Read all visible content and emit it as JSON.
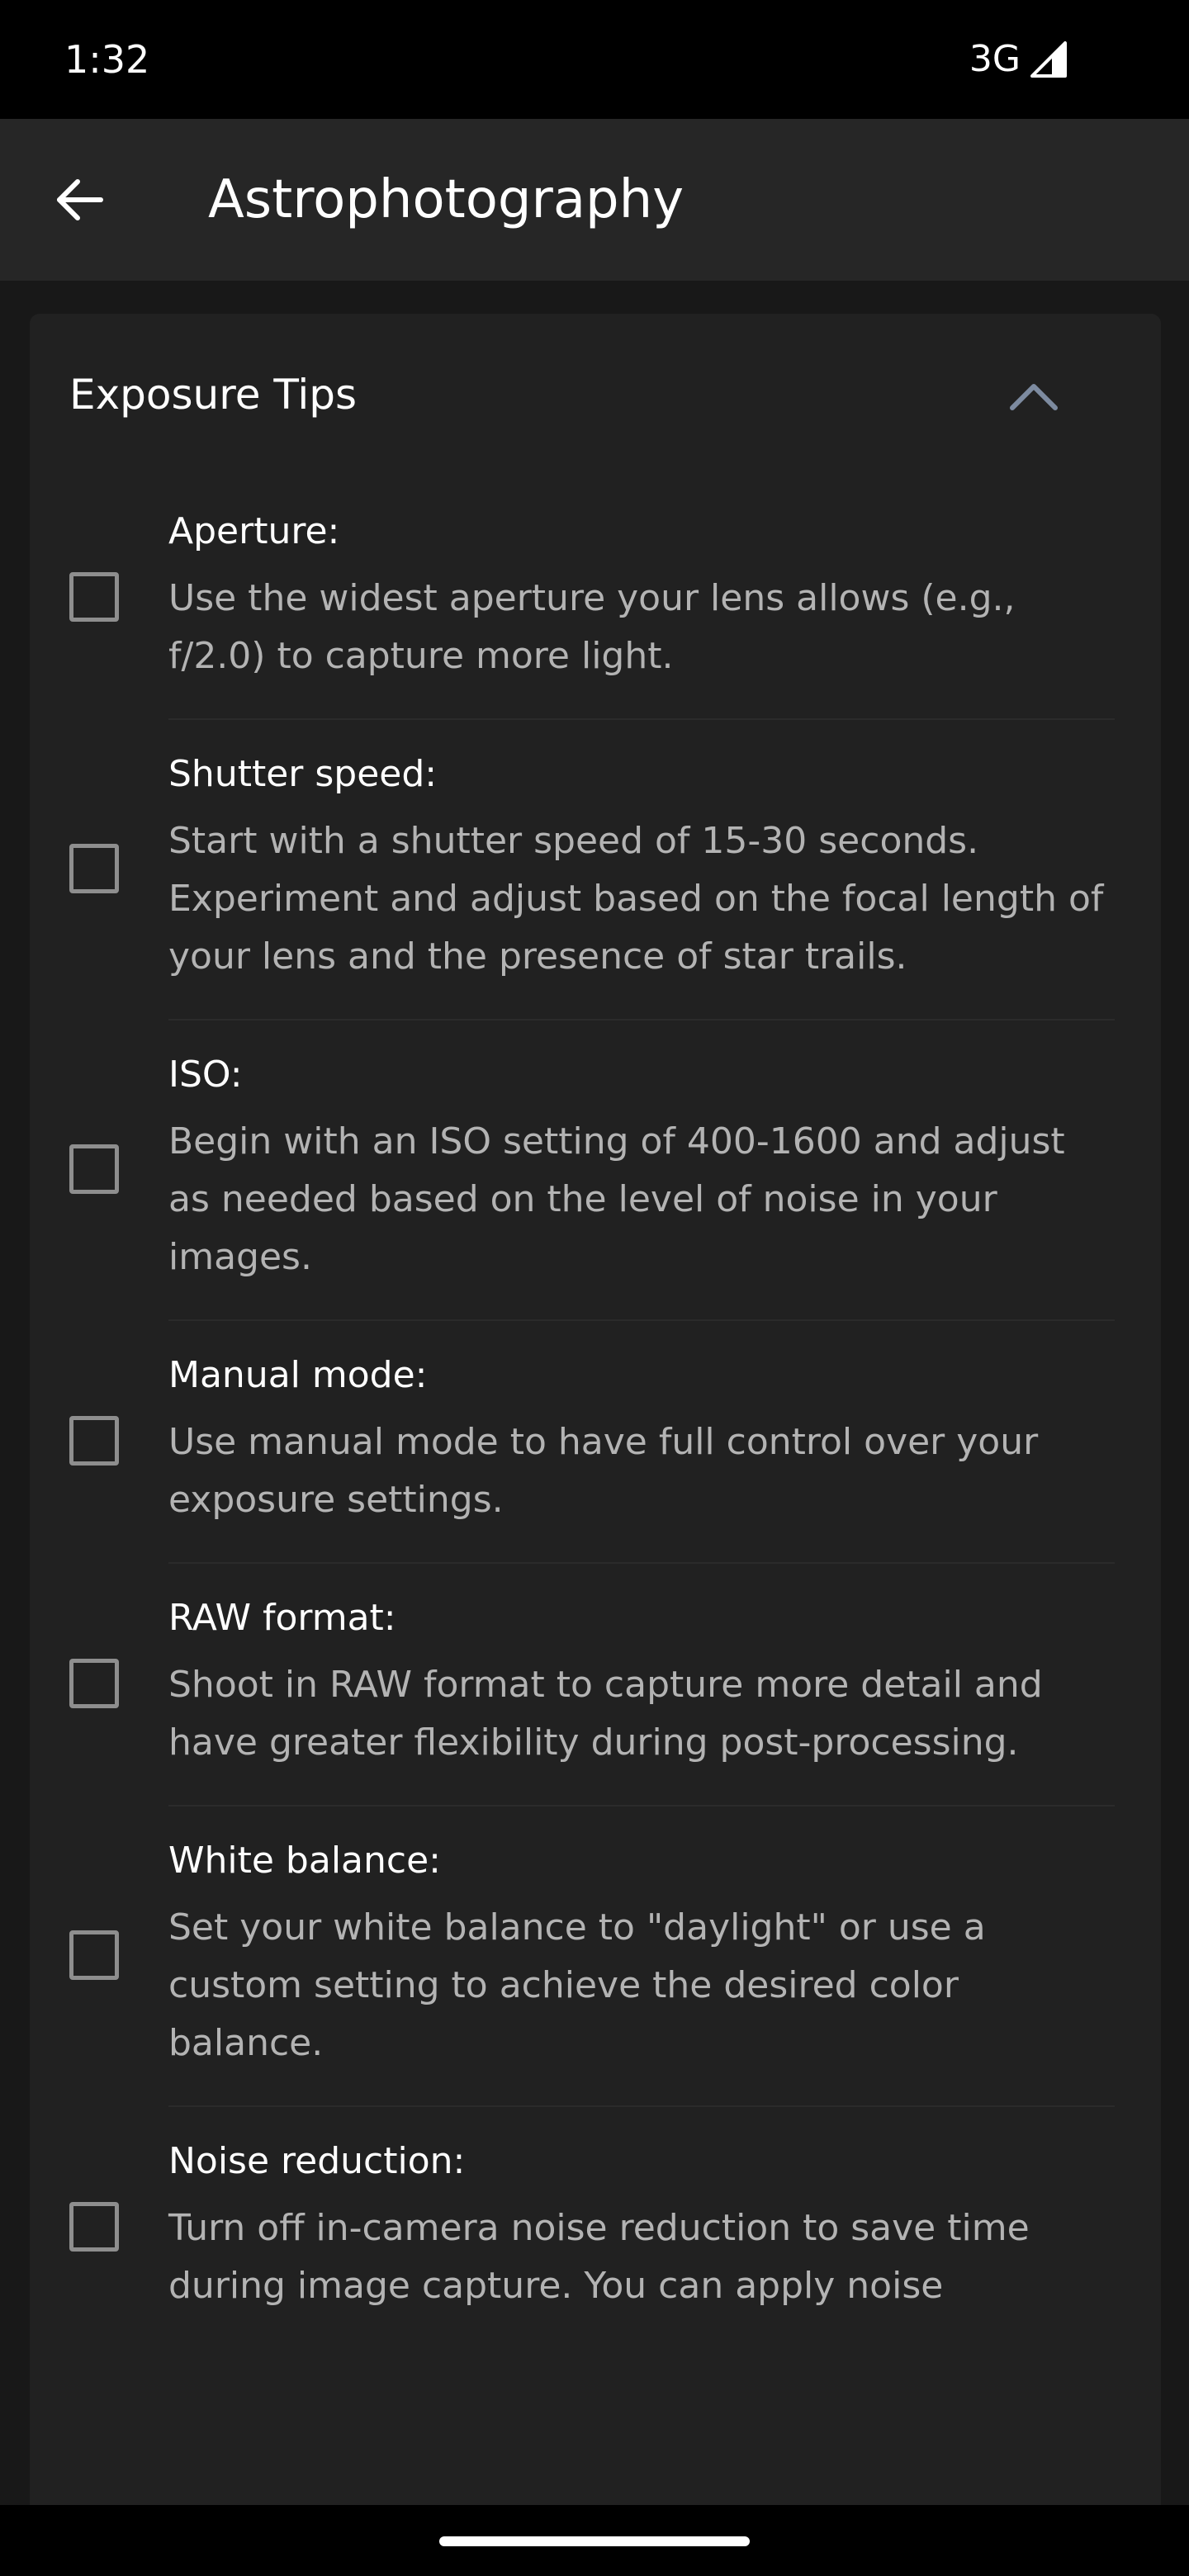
{
  "status_bar": {
    "time": "1:32",
    "network": "3G"
  },
  "app_bar": {
    "title": "Astrophotography",
    "back_icon": "arrow-left-icon"
  },
  "card": {
    "title": "Exposure Tips",
    "collapse_icon": "chevron-up-icon",
    "expanded": true,
    "tips": [
      {
        "title": "Aperture:",
        "description": "Use the widest aperture your lens allows (e.g., f/2.0) to capture more light.",
        "checked": false
      },
      {
        "title": "Shutter speed:",
        "description": "Start with a shutter speed of 15-30 seconds. Experiment and adjust based on the focal length of your lens and the presence of star trails.",
        "checked": false
      },
      {
        "title": "ISO:",
        "description": "Begin with an ISO setting of 400-1600 and adjust as needed based on the level of noise in your images.",
        "checked": false
      },
      {
        "title": "Manual mode:",
        "description": "Use manual mode to have full control over your exposure settings.",
        "checked": false
      },
      {
        "title": "RAW format:",
        "description": "Shoot in RAW format to capture more detail and have greater flexibility during post-processing.",
        "checked": false
      },
      {
        "title": "White balance:",
        "description": "Set your white balance to \"daylight\" or use a custom setting to achieve the desired color balance.",
        "checked": false
      },
      {
        "title": "Noise reduction:",
        "description": "Turn off in-camera noise reduction to save time during image capture. You can apply noise",
        "checked": false
      }
    ]
  },
  "colors": {
    "background": "#181818",
    "app_bar": "#262626",
    "card": "#212121",
    "text_primary": "#ffffff",
    "text_secondary": "#b3b3b3",
    "checkbox_border": "#8e8e8e",
    "chevron": "#7d8ba0"
  }
}
